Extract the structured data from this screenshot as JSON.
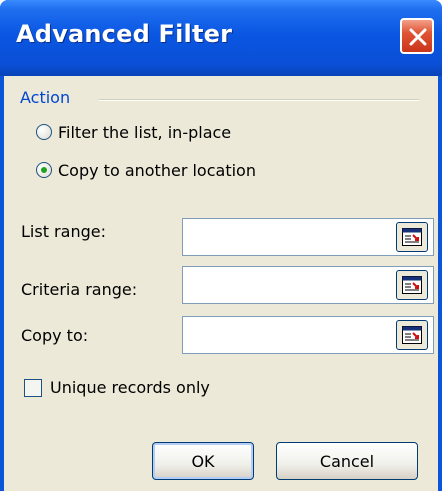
{
  "dialog": {
    "title": "Advanced Filter"
  },
  "action": {
    "group_label": "Action",
    "options": [
      {
        "label": "Filter the list, in-place",
        "selected": false
      },
      {
        "label": "Copy to another location",
        "selected": true
      }
    ]
  },
  "fields": {
    "list_range": {
      "label": "List range:",
      "value": ""
    },
    "criteria_range": {
      "label": "Criteria range:",
      "value": ""
    },
    "copy_to": {
      "label": "Copy to:",
      "value": ""
    }
  },
  "unique_records": {
    "label": "Unique records only",
    "checked": false
  },
  "buttons": {
    "ok": "OK",
    "cancel": "Cancel"
  },
  "colors": {
    "title_bar": "#0a56e2",
    "dialog_bg": "#ece9d8",
    "group_label": "#0046d5",
    "close_button": "#e05535"
  },
  "icons": {
    "close": "close-icon",
    "range_selector": "collapse-dialog-icon"
  }
}
